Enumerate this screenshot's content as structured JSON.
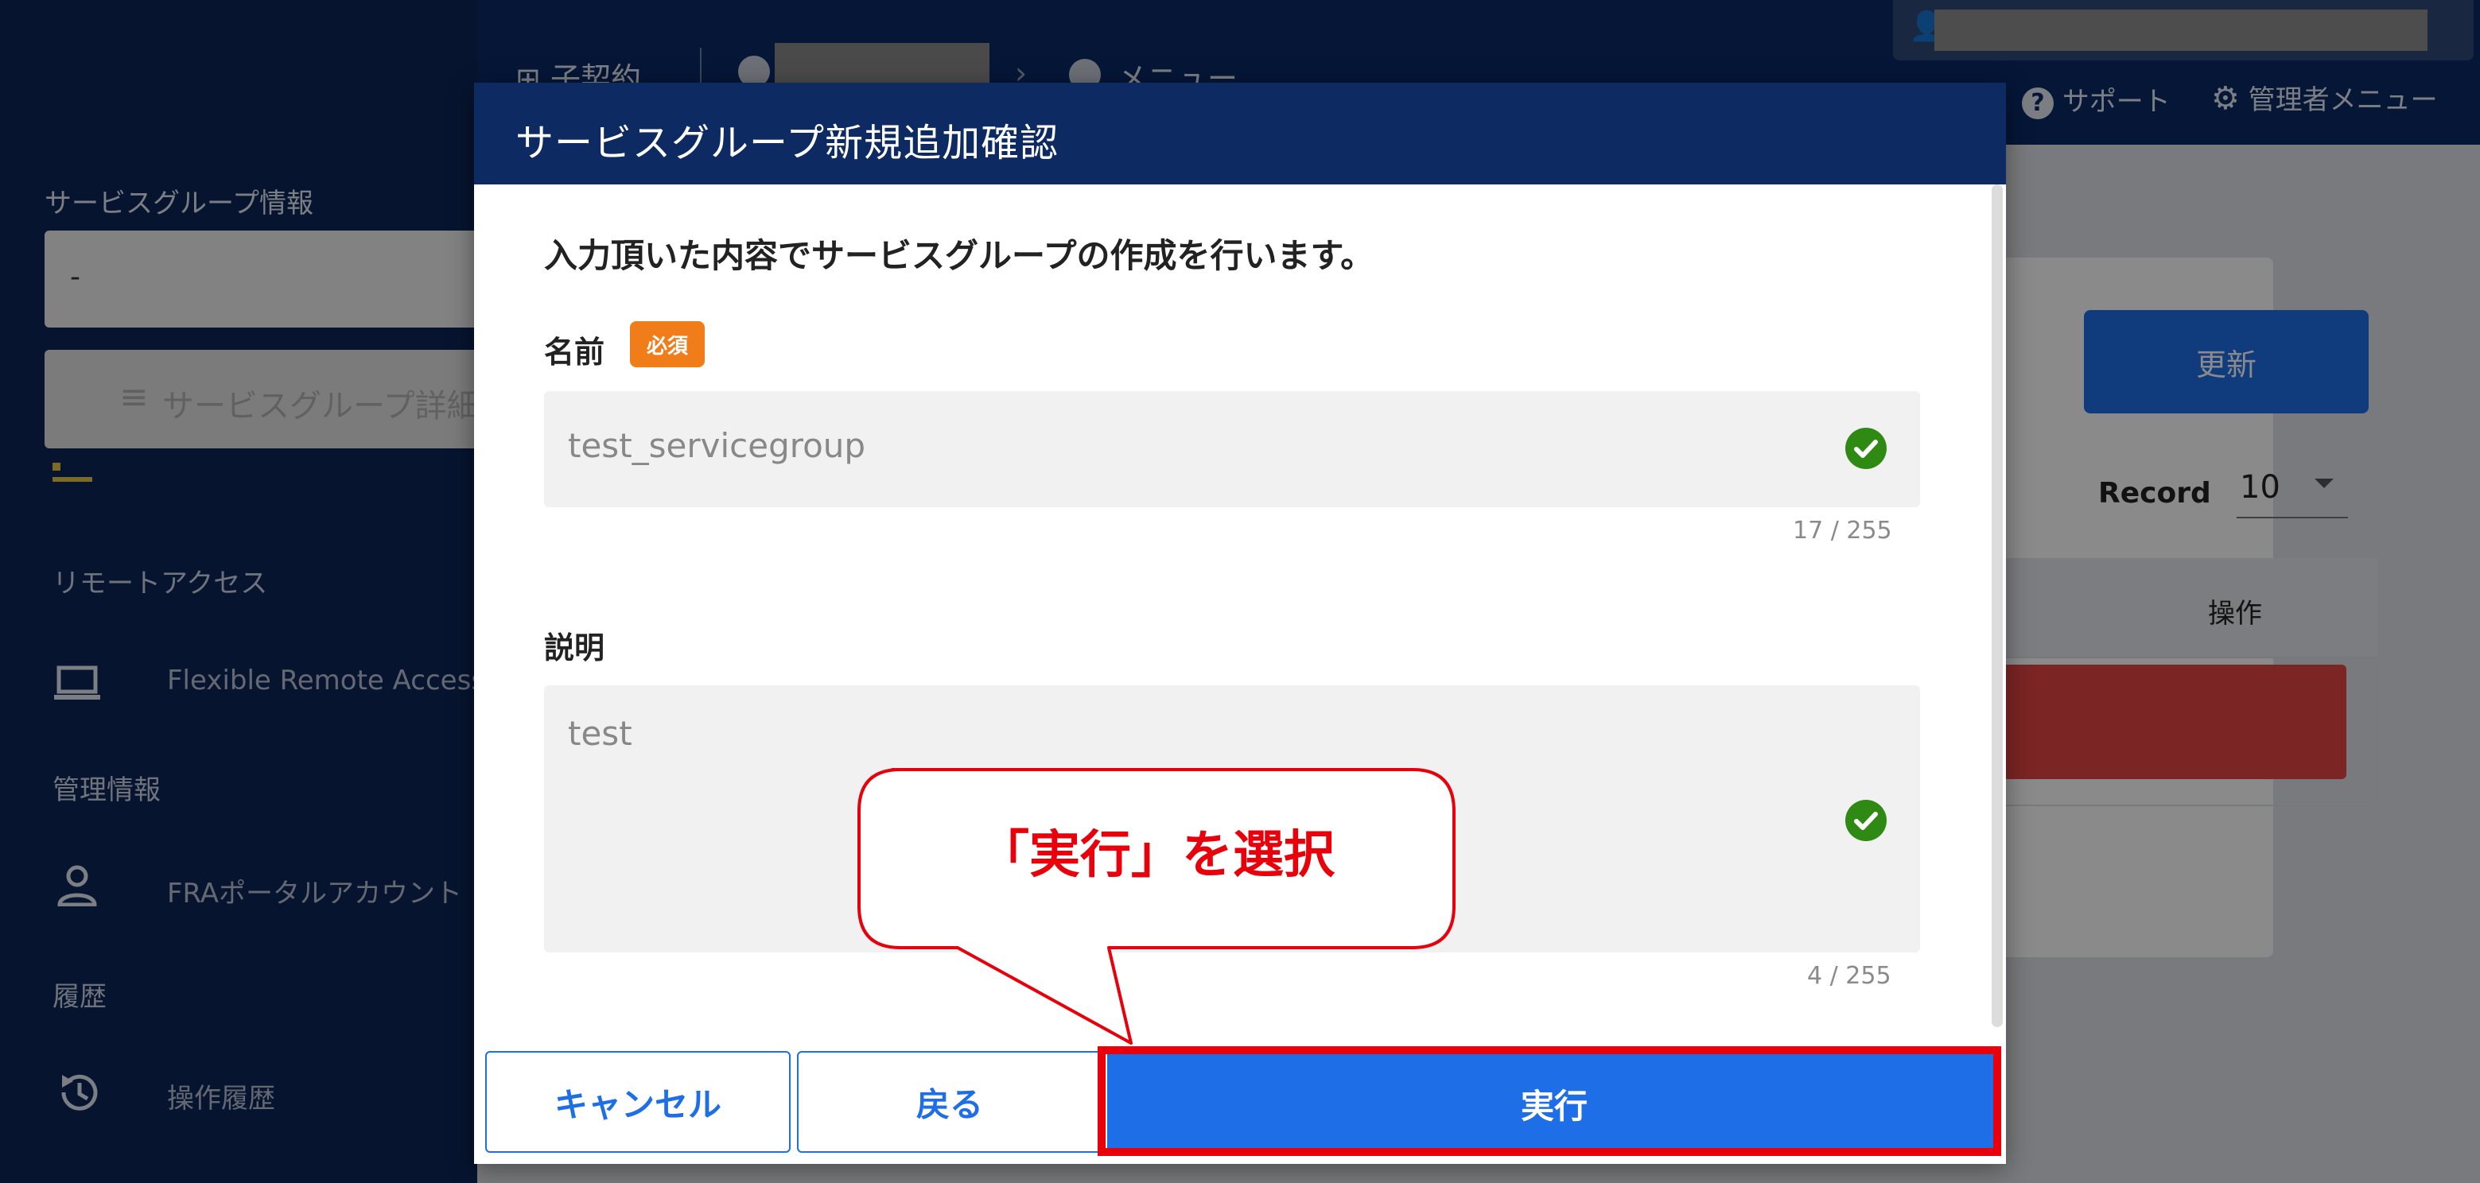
{
  "background": {
    "header": {
      "breadcrumb_parent": "子契約",
      "breadcrumb_menu": "メニュー",
      "support_label": "サポート",
      "admin_menu_label": "管理者メニュー"
    },
    "sidebar": {
      "section_label": "サービスグループ情報",
      "input_value": "-",
      "detail_button_label": "サービスグループ詳細",
      "items": [
        {
          "type": "heading",
          "label": "リモートアクセス"
        },
        {
          "type": "item",
          "label": "Flexible Remote Access",
          "icon": "laptop-icon"
        },
        {
          "type": "heading",
          "label": "管理情報"
        },
        {
          "type": "item",
          "label": "FRAポータルアカウント",
          "icon": "person-icon"
        },
        {
          "type": "heading",
          "label": "履歴"
        },
        {
          "type": "item",
          "label": "操作履歴",
          "icon": "history-icon"
        }
      ]
    },
    "main": {
      "update_button_label": "更新",
      "record_label": "Record",
      "record_value": "10",
      "table_header_operation": "操作"
    }
  },
  "modal": {
    "title": "サービスグループ新規追加確認",
    "message": "入力頂いた内容でサービスグループの作成を行います。",
    "name_label": "名前",
    "required_badge": "必須",
    "name_value": "test_servicegroup",
    "name_counter": "17 / 255",
    "description_label": "説明",
    "description_value": "test",
    "description_counter": "4 / 255",
    "cancel_label": "キャンセル",
    "back_label": "戻る",
    "execute_label": "実行"
  },
  "annotation": {
    "callout_text": "「実行」を選択"
  },
  "colors": {
    "header_navy": "#0d2a63",
    "primary_blue": "#1e6ee8",
    "required_orange": "#f07c1a",
    "check_green": "#2e8a13",
    "highlight_red": "#e8000b"
  }
}
